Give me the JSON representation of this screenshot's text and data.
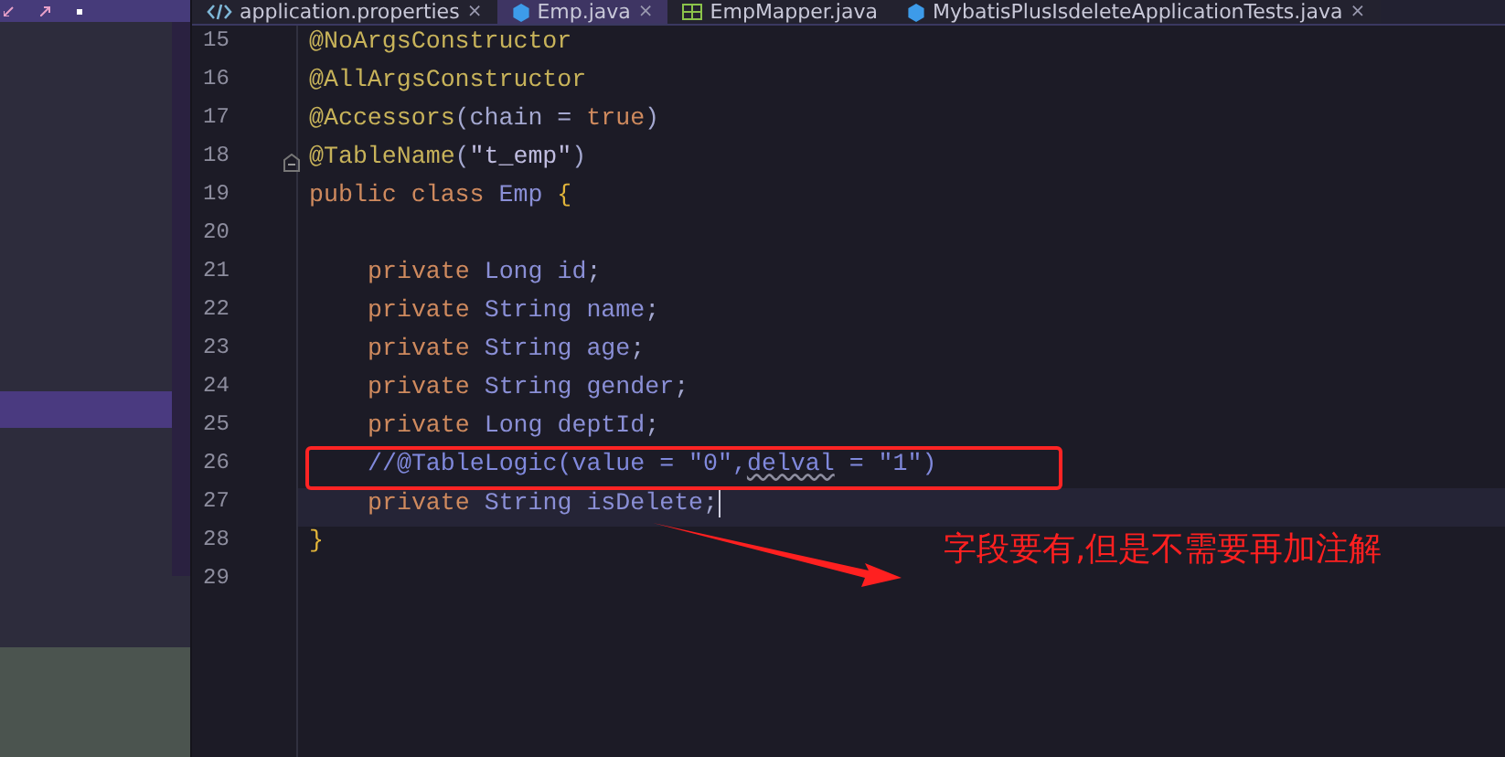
{
  "tabs": [
    {
      "label": "application.properties",
      "kind": "code",
      "selected": false,
      "close": "×"
    },
    {
      "label": "Emp.java",
      "kind": "class",
      "selected": true,
      "close": "×"
    },
    {
      "label": "EmpMapper.java",
      "kind": "mapper",
      "selected": false
    },
    {
      "label": "MybatisPlusIsdeleteApplicationTests.java",
      "kind": "class",
      "selected": false,
      "close": "×"
    }
  ],
  "lines": [
    {
      "number": "15",
      "tokens": [
        {
          "kind": "annotation",
          "text": "@NoArgsConstructor"
        }
      ]
    },
    {
      "number": "16",
      "tokens": [
        {
          "kind": "annotation",
          "text": "@AllArgsConstructor"
        }
      ]
    },
    {
      "number": "17",
      "tokens": [
        {
          "kind": "annotation",
          "text": "@Accessors"
        },
        {
          "kind": "punct",
          "text": "(chain = "
        },
        {
          "kind": "keyword",
          "text": "true"
        },
        {
          "kind": "punct",
          "text": ")"
        }
      ]
    },
    {
      "number": "18",
      "fold": true,
      "tokens": [
        {
          "kind": "annotation",
          "text": "@TableName"
        },
        {
          "kind": "punct",
          "text": "("
        },
        {
          "kind": "string",
          "text": "\"t_emp\""
        },
        {
          "kind": "punct",
          "text": ")"
        }
      ]
    },
    {
      "number": "19",
      "tokens": [
        {
          "kind": "keyword",
          "text": "public class "
        },
        {
          "kind": "type",
          "text": "Emp "
        },
        {
          "kind": "brace",
          "text": "{"
        }
      ]
    },
    {
      "number": "20"
    },
    {
      "number": "21",
      "indent": true,
      "tokens": [
        {
          "kind": "keyword",
          "text": "private "
        },
        {
          "kind": "type",
          "text": "Long id"
        },
        {
          "kind": "punct",
          "text": ";"
        }
      ]
    },
    {
      "number": "22",
      "indent": true,
      "tokens": [
        {
          "kind": "keyword",
          "text": "private "
        },
        {
          "kind": "type",
          "text": "String name"
        },
        {
          "kind": "punct",
          "text": ";"
        }
      ]
    },
    {
      "number": "23",
      "indent": true,
      "tokens": [
        {
          "kind": "keyword",
          "text": "private "
        },
        {
          "kind": "type",
          "text": "String age"
        },
        {
          "kind": "punct",
          "text": ";"
        }
      ]
    },
    {
      "number": "24",
      "indent": true,
      "tokens": [
        {
          "kind": "keyword",
          "text": "private "
        },
        {
          "kind": "type",
          "text": "String gender"
        },
        {
          "kind": "punct",
          "text": ";"
        }
      ]
    },
    {
      "number": "25",
      "indent": true,
      "tokens": [
        {
          "kind": "keyword",
          "text": "private "
        },
        {
          "kind": "type",
          "text": "Long deptId"
        },
        {
          "kind": "punct",
          "text": ";"
        }
      ]
    },
    {
      "number": "26",
      "indent": true,
      "boxed": true,
      "tokens": [
        {
          "kind": "comment",
          "text": "//@TableLogic(value = \"0\","
        },
        {
          "kind": "comment",
          "text": "delval",
          "squiggle": true
        },
        {
          "kind": "comment",
          "text": " = \"1\")"
        }
      ]
    },
    {
      "number": "27",
      "indent": true,
      "current": true,
      "tokens": [
        {
          "kind": "keyword",
          "text": "private "
        },
        {
          "kind": "type",
          "text": "String isDelete"
        },
        {
          "kind": "punct",
          "text": ";"
        }
      ]
    },
    {
      "number": "28",
      "tokens": [
        {
          "kind": "brace",
          "text": "}"
        }
      ]
    },
    {
      "number": "29"
    }
  ],
  "callout": {
    "text": "字段要有,但是不需要再加注解"
  }
}
